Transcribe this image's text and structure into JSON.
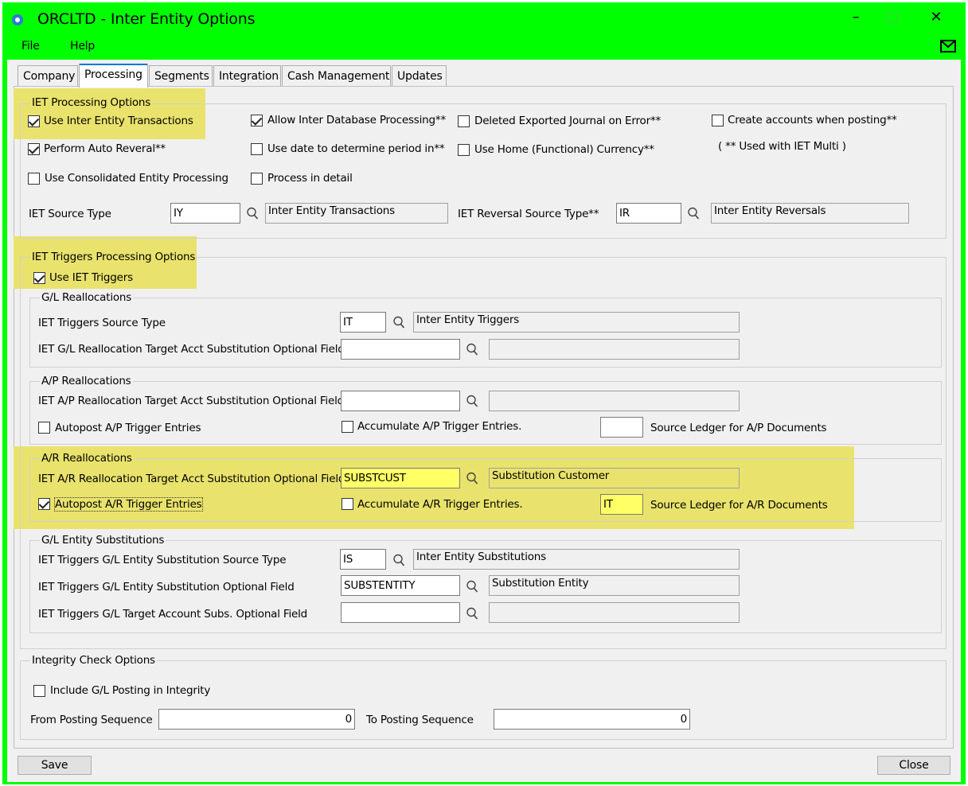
{
  "window": {
    "title": "ORCLTD - Inter Entity Options",
    "minimize": "–",
    "maximize": "□",
    "close": "✕"
  },
  "menu": {
    "file": "File",
    "help": "Help"
  },
  "tabs": [
    "Company",
    "Processing",
    "Segments",
    "Integration",
    "Cash Management",
    "Updates"
  ],
  "iet": {
    "group_title": "IET Processing Options",
    "use_iet": "Use Inter Entity Transactions",
    "allow_interdb": "Allow Inter Database Processing**",
    "deleted_exported": "Deleted Exported Journal on Error**",
    "create_accounts": "Create accounts when posting**",
    "auto_reversal": "Perform Auto Reveral**",
    "use_date": "Use date to determine period in**",
    "use_home": "Use Home (Functional) Currency**",
    "iet_multi_note": "( ** Used with IET Multi )",
    "consolidated": "Use Consolidated Entity Processing",
    "process_detail": "Process in detail",
    "source_type_label": "IET Source Type",
    "source_type_value": "IY",
    "source_type_desc": "Inter Entity Transactions",
    "reversal_label": "IET Reversal Source Type**",
    "reversal_value": "IR",
    "reversal_desc": "Inter Entity Reversals"
  },
  "triggers": {
    "group_title": "IET Triggers Processing Options",
    "use_triggers": "Use IET Triggers",
    "gl": {
      "title": "G/L Reallocations",
      "source_label": "IET Triggers Source Type",
      "source_value": "IT",
      "source_desc": "Inter Entity Triggers",
      "target_label": "IET G/L Reallocation Target Acct Substitution Optional Field",
      "target_value": "",
      "target_desc": ""
    },
    "ap": {
      "title": "A/P Reallocations",
      "target_label": "IET A/P Reallocation Target Acct Substitution Optional Field",
      "target_value": "",
      "target_desc": "",
      "autopost": "Autopost A/P Trigger Entries",
      "accumulate": "Accumulate A/P Trigger Entries.",
      "ledger_value": "",
      "ledger_label": "Source Ledger for A/P Documents"
    },
    "ar": {
      "title": "A/R Reallocations",
      "target_label": "IET A/R Reallocation Target Acct Substitution Optional Field",
      "target_value": "SUBSTCUST",
      "target_desc": "Substitution Customer",
      "autopost": "Autopost A/R Trigger Entries",
      "accumulate": "Accumulate A/R Trigger Entries.",
      "ledger_value": "IT",
      "ledger_label": "Source Ledger for A/R Documents"
    },
    "ent": {
      "title": "G/L Entity Substitutions",
      "source_label": "IET Triggers G/L Entity Substitution Source Type",
      "source_value": "IS",
      "source_desc": "Inter Entity Substitutions",
      "opt_label": "IET Triggers G/L Entity Substitution Optional Field",
      "opt_value": "SUBSTENTITY",
      "opt_desc": "Substitution Entity",
      "target_label": "IET Triggers G/L Target Account Subs. Optional Field",
      "target_value": "",
      "target_desc": ""
    }
  },
  "integrity": {
    "title": "Integrity Check Options",
    "include": "Include G/L Posting in Integrity",
    "from_label": "From Posting Sequence",
    "from_value": "0",
    "to_label": "To Posting Sequence",
    "to_value": "0"
  },
  "buttons": {
    "save": "Save",
    "close": "Close"
  }
}
